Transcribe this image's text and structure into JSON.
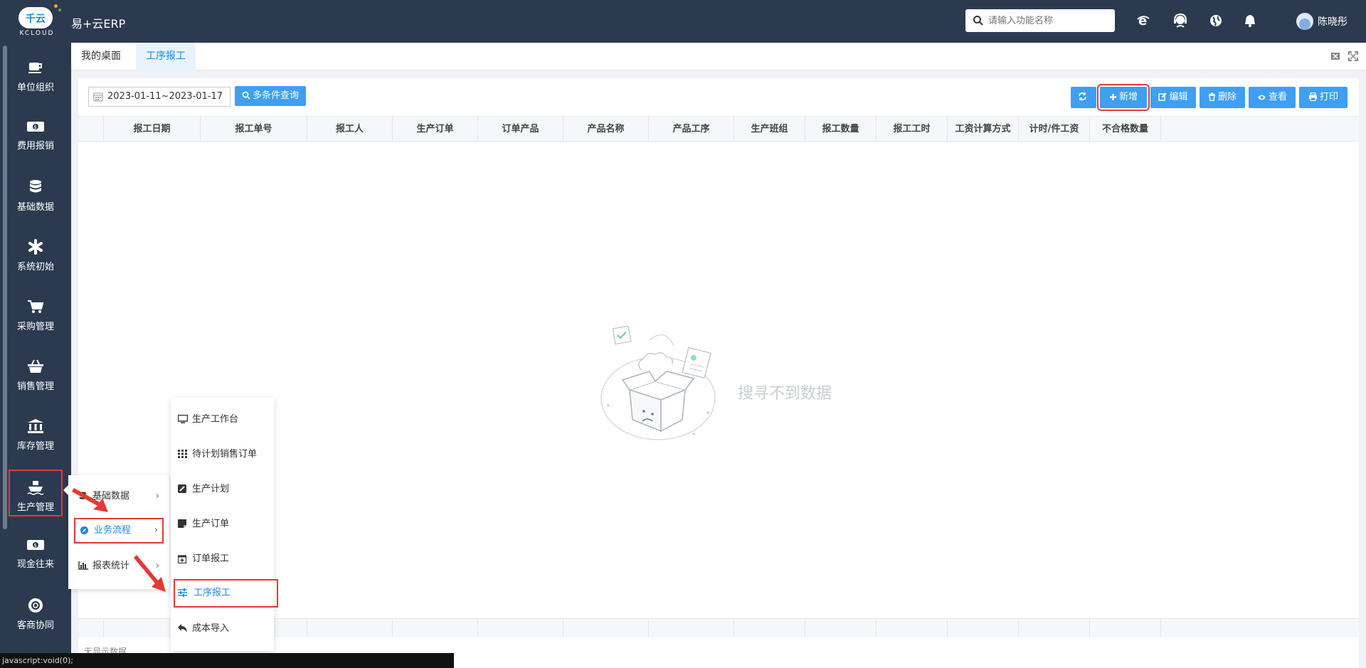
{
  "header": {
    "logo_text": "千云",
    "logo_sub": "KCLOUD",
    "app_title": "易+云ERP",
    "search_placeholder": "请输入功能名称",
    "user_name": "陈晓彤",
    "icons": [
      "ie-icon",
      "support-icon",
      "globe-icon",
      "bell-icon"
    ]
  },
  "sidebar": {
    "items": [
      {
        "label": "单位组织",
        "icon": "coffee-icon"
      },
      {
        "label": "费用报销",
        "icon": "money-icon"
      },
      {
        "label": "基础数据",
        "icon": "database-icon"
      },
      {
        "label": "系统初始",
        "icon": "asterisk-icon"
      },
      {
        "label": "采购管理",
        "icon": "cart-icon"
      },
      {
        "label": "销售管理",
        "icon": "basket-icon"
      },
      {
        "label": "库存管理",
        "icon": "bank-icon"
      },
      {
        "label": "生产管理",
        "icon": "ship-icon",
        "active": true
      },
      {
        "label": "现金往来",
        "icon": "money-icon"
      },
      {
        "label": "客商协同",
        "icon": "lifebuoy-icon"
      }
    ]
  },
  "tabs": [
    {
      "label": "我的桌面"
    },
    {
      "label": "工序报工",
      "active": true
    }
  ],
  "toolbar": {
    "date_range": "2023-01-11~2023-01-17",
    "query_label": "多条件查询",
    "add_label": "新增",
    "edit_label": "编辑",
    "delete_label": "删除",
    "view_label": "查看",
    "print_label": "打印"
  },
  "table": {
    "columns": [
      "报工日期",
      "报工单号",
      "报工人",
      "生产订单",
      "订单产品",
      "产品名称",
      "产品工序",
      "生产班组",
      "报工数量",
      "报工工时",
      "工资计算方式",
      "计时/件工资",
      "不合格数量"
    ],
    "empty_text": "搜寻不到数据",
    "footer_text": "无显示数据"
  },
  "menu_level1": [
    {
      "label": "基础数据",
      "icon": "database-icon"
    },
    {
      "label": "业务流程",
      "icon": "compass-icon",
      "active": true
    },
    {
      "label": "报表统计",
      "icon": "bar-chart-icon"
    }
  ],
  "menu_level2": [
    {
      "label": "生产工作台",
      "icon": "monitor-icon"
    },
    {
      "label": "待计划销售订单",
      "icon": "grid-icon"
    },
    {
      "label": "生产计划",
      "icon": "edit-icon"
    },
    {
      "label": "生产订单",
      "icon": "note-icon"
    },
    {
      "label": "订单报工",
      "icon": "calendar-plus-icon"
    },
    {
      "label": "工序报工",
      "icon": "sliders-icon",
      "active": true
    },
    {
      "label": "成本导入",
      "icon": "reply-icon"
    }
  ],
  "status_bar": "javascript:void(0);",
  "colors": {
    "accent": "#3e9ff3",
    "nav_bg": "#2b3a4f",
    "highlight": "#e53935"
  }
}
